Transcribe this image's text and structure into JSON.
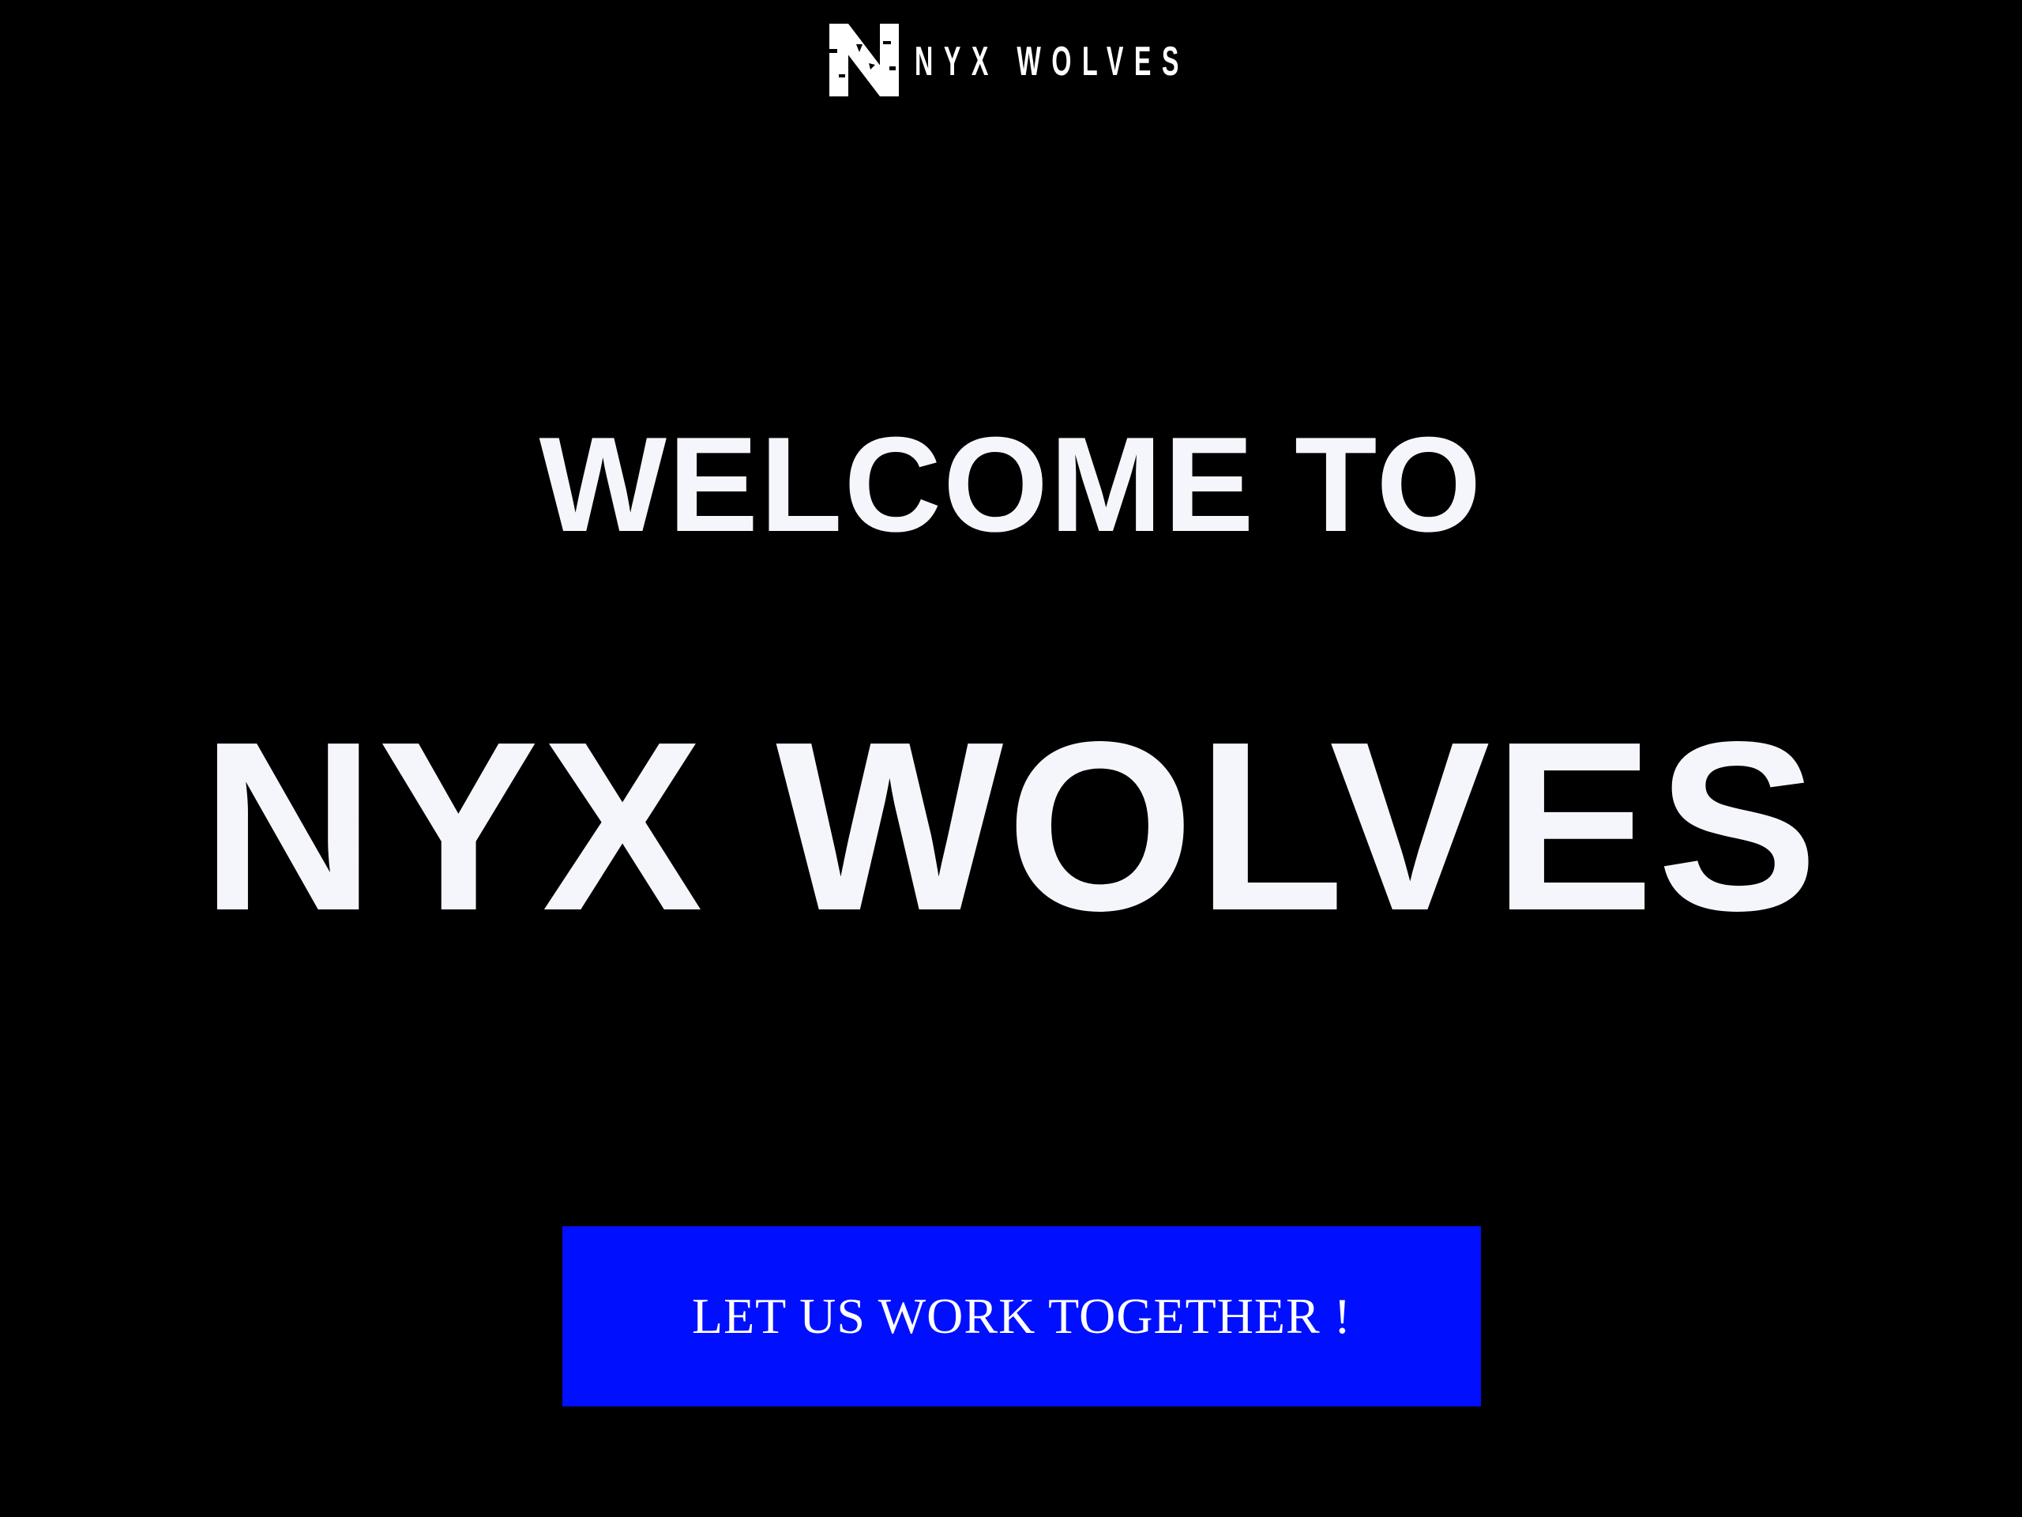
{
  "header": {
    "logo_text": "NYX WOLVES",
    "logo_icon": "n-monogram-logo-icon"
  },
  "hero": {
    "line1": "WELCOME TO",
    "line2": "NYX WOLVES"
  },
  "cta": {
    "label": "LET US WORK TOGETHER !"
  },
  "colors": {
    "background": "#000000",
    "text": "#f4f6fb",
    "cta_background": "#0010ff",
    "cta_text": "#ffffff"
  }
}
